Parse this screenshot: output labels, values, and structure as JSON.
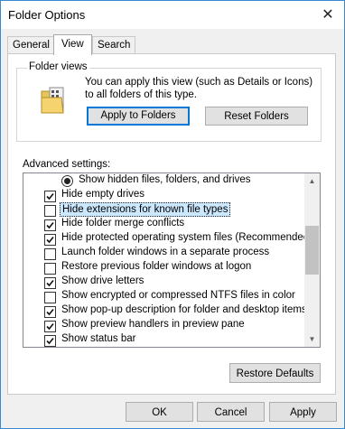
{
  "window": {
    "title": "Folder Options",
    "close_glyph": "✕"
  },
  "tabs": [
    {
      "label": "General",
      "active": false
    },
    {
      "label": "View",
      "active": true
    },
    {
      "label": "Search",
      "active": false
    }
  ],
  "folder_views": {
    "label": "Folder views",
    "icon": "folder-icon",
    "description": "You can apply this view (such as Details or Icons) to all folders of this type.",
    "apply_button": "Apply to Folders",
    "reset_button": "Reset Folders"
  },
  "advanced": {
    "label": "Advanced settings:",
    "items": [
      {
        "type": "radio",
        "label": "Show hidden files, folders, and drives",
        "checked": true
      },
      {
        "type": "checkbox",
        "label": "Hide empty drives",
        "checked": true
      },
      {
        "type": "checkbox",
        "label": "Hide extensions for known file types",
        "checked": false,
        "selected": true
      },
      {
        "type": "checkbox",
        "label": "Hide folder merge conflicts",
        "checked": true
      },
      {
        "type": "checkbox",
        "label": "Hide protected operating system files (Recommended)",
        "checked": true
      },
      {
        "type": "checkbox",
        "label": "Launch folder windows in a separate process",
        "checked": false
      },
      {
        "type": "checkbox",
        "label": "Restore previous folder windows at logon",
        "checked": false
      },
      {
        "type": "checkbox",
        "label": "Show drive letters",
        "checked": true
      },
      {
        "type": "checkbox",
        "label": "Show encrypted or compressed NTFS files in color",
        "checked": false
      },
      {
        "type": "checkbox",
        "label": "Show pop-up description for folder and desktop items",
        "checked": true
      },
      {
        "type": "checkbox",
        "label": "Show preview handlers in preview pane",
        "checked": true
      },
      {
        "type": "checkbox",
        "label": "Show status bar",
        "checked": true
      }
    ],
    "restore_button": "Restore Defaults"
  },
  "footer": {
    "ok": "OK",
    "cancel": "Cancel",
    "apply": "Apply"
  },
  "colors": {
    "accent": "#0078d7",
    "selection": "#cce8ff",
    "border": "#3a8ad1"
  }
}
